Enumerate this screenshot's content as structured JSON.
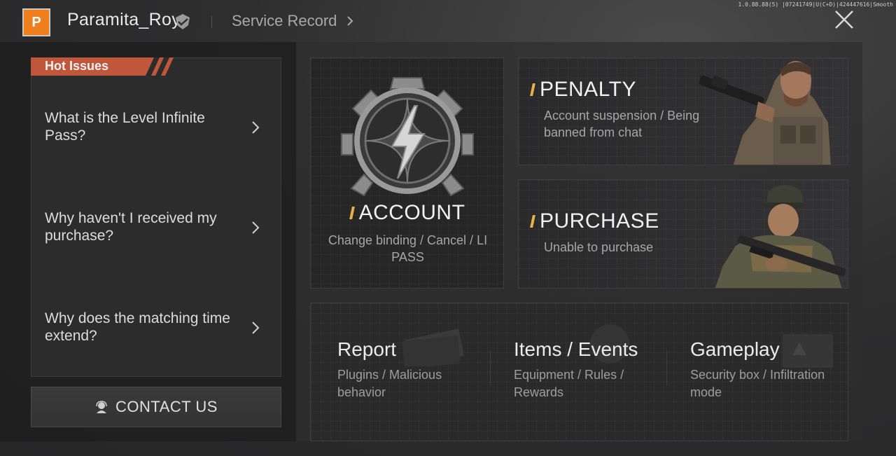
{
  "header": {
    "avatar_letter": "P",
    "username": "Paramita_Roy",
    "service_record": "Service Record",
    "version": "1.0.88.88(5) |07241749|U(C+D)|424447616|Smooth"
  },
  "hot_issues": {
    "tag": "Hot Issues",
    "items": [
      {
        "text": "What is the Level Infinite Pass?"
      },
      {
        "text": "Why haven't I received my purchase?"
      },
      {
        "text": "Why does the matching time extend?"
      }
    ]
  },
  "contact": {
    "label": "CONTACT US"
  },
  "cards": {
    "account": {
      "title": "ACCOUNT",
      "subtitle": "Change binding / Cancel / LI PASS"
    },
    "penalty": {
      "title": "PENALTY",
      "subtitle": "Account suspension / Being banned from chat"
    },
    "purchase": {
      "title": "PURCHASE",
      "subtitle": "Unable to purchase"
    }
  },
  "categories": [
    {
      "title": "Report",
      "subtitle": "Plugins / Malicious behavior"
    },
    {
      "title": "Items / Events",
      "subtitle": "Equipment / Rules / Rewards"
    },
    {
      "title": "Gameplay",
      "subtitle": "Security box / Infiltration mode"
    }
  ],
  "colors": {
    "avatar_bg": "#f07e1c",
    "hot_tag": "#c0573a",
    "accent": "#e8b04a",
    "background": "#2b2b2c"
  }
}
